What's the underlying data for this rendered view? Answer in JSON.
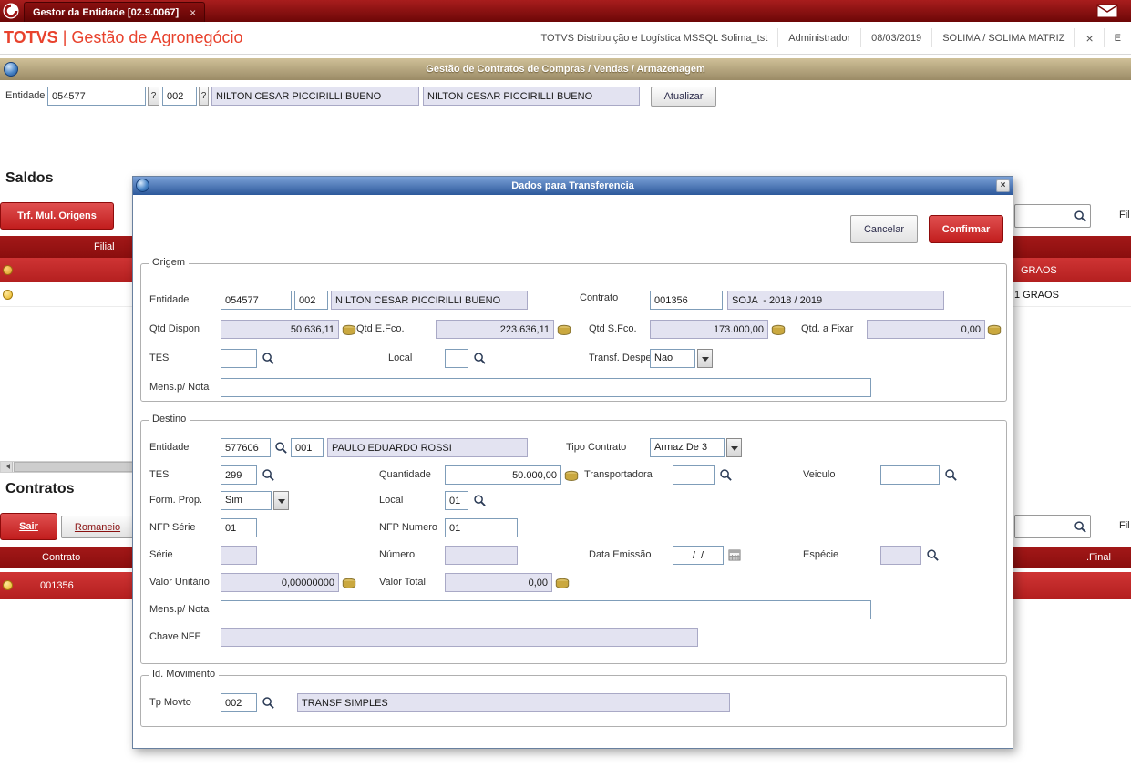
{
  "accent": {
    "totvs_red": "#c11d1d",
    "title_tan": "#ab9b74",
    "modal_blue": "#2c589a",
    "readonly_bg": "#e3e3f1"
  },
  "taskbar": {
    "tab_label": "Gestor da Entidade [02.9.0067]",
    "close": "×"
  },
  "header": {
    "brand_bold": "TOTVS",
    "brand_rest": "| Gestão de Agronegócio",
    "environment": "TOTVS Distribuição e Logística MSSQL Solima_tst",
    "user": "Administrador",
    "date": "08/03/2019",
    "branch": "SOLIMA / SOLIMA MATRIZ",
    "close": "×",
    "exit_partial": "E"
  },
  "titlebar": {
    "title": "Gestão de Contratos de Compras / Vendas / Armazenagem"
  },
  "entity_bar": {
    "label": "Entidade",
    "code": "054577",
    "help1": "?",
    "store": "002",
    "help2": "?",
    "name": "NILTON CESAR PICCIRILLI BUENO",
    "name2": "NILTON CESAR PICCIRILLI BUENO",
    "refresh": "Atualizar"
  },
  "saldos": {
    "heading": "Saldos",
    "btn_trf": "Trf. Mul. Origens",
    "col_filial": "Filial",
    "row1_text": "GRAOS",
    "row2_text": "1 GRAOS",
    "filter_label": "Fil"
  },
  "contratos": {
    "heading": "Contratos",
    "btn_sair": "Sair",
    "btn_romaneio": "Romaneio",
    "col_contrato": "Contrato",
    "col_final": ".Final",
    "row1_contrato": "001356",
    "filter_label": "Fil"
  },
  "modal": {
    "title": "Dados para Transferencia",
    "close": "×",
    "cancel": "Cancelar",
    "confirm": "Confirmar",
    "origem": {
      "legend": "Origem",
      "entidade_label": "Entidade",
      "entidade_code": "054577",
      "entidade_store": "002",
      "entidade_name": "NILTON CESAR PICCIRILLI BUENO",
      "contrato_label": "Contrato",
      "contrato_code": "001356",
      "contrato_desc": "SOJA  - 2018 / 2019",
      "qtd_dispon_label": "Qtd Dispon",
      "qtd_dispon": "50.636,11",
      "qtd_efco_label": "Qtd E.Fco.",
      "qtd_efco": "223.636,11",
      "qtd_sfco_label": "Qtd S.Fco.",
      "qtd_sfco": "173.000,00",
      "qtd_fixar_label": "Qtd. a Fixar",
      "qtd_fixar": "0,00",
      "tes_label": "TES",
      "tes": "",
      "local_label": "Local",
      "local": "",
      "transf_despesa_label": "Transf. Despesa",
      "transf_despesa": "Nao",
      "mens_label": "Mens.p/ Nota",
      "mens": ""
    },
    "destino": {
      "legend": "Destino",
      "entidade_label": "Entidade",
      "entidade_code": "577606",
      "entidade_store": "001",
      "entidade_name": "PAULO EDUARDO ROSSI",
      "tipo_contrato_label": "Tipo Contrato",
      "tipo_contrato": "Armaz De 3",
      "tes_label": "TES",
      "tes": "299",
      "quantidade_label": "Quantidade",
      "quantidade": "50.000,00",
      "transportadora_label": "Transportadora",
      "transportadora": "",
      "veiculo_label": "Veiculo",
      "veiculo": "",
      "form_prop_label": "Form. Prop.",
      "form_prop": "Sim",
      "local_label": "Local",
      "local": "01",
      "nfp_serie_label": "NFP Série",
      "nfp_serie": "01",
      "nfp_numero_label": "NFP Numero",
      "nfp_numero": "01",
      "serie_label": "Série",
      "serie": "",
      "numero_label": "Número",
      "numero": "",
      "data_emissao_label": "Data Emissão",
      "data_emissao": "/  /",
      "especie_label": "Espécie",
      "especie": "",
      "valor_unitario_label": "Valor Unitário",
      "valor_unitario": "0,00000000",
      "valor_total_label": "Valor Total",
      "valor_total": "0,00",
      "mens_label": "Mens.p/ Nota",
      "mens": "",
      "chave_nfe_label": "Chave NFE",
      "chave_nfe": ""
    },
    "movimento": {
      "legend": "Id. Movimento",
      "tp_movto_label": "Tp Movto",
      "tp_movto": "002",
      "tp_movto_desc": "TRANSF SIMPLES"
    }
  }
}
